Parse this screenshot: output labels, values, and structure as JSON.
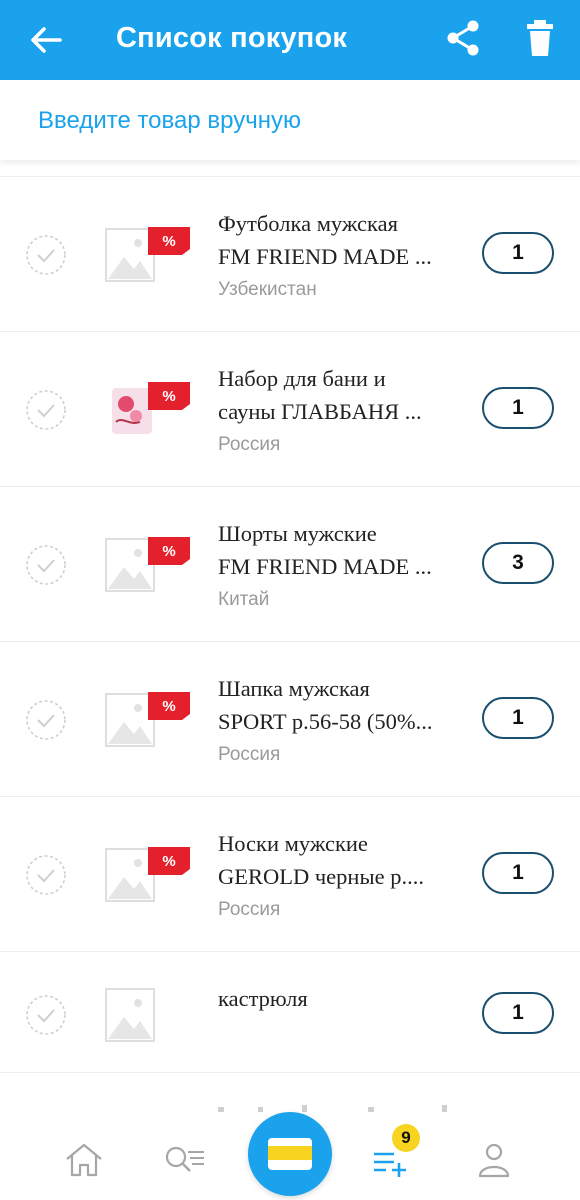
{
  "header": {
    "title": "Список покупок",
    "back_icon": "arrow-left-icon",
    "share_icon": "share-icon",
    "delete_icon": "trash-icon",
    "background": "#1aa3ec"
  },
  "manual_entry": {
    "placeholder": "Введите товар вручную"
  },
  "items": [
    {
      "line1": "Футболка мужская",
      "line2": "FM FRIEND MADE ...",
      "origin": "Узбекистан",
      "qty": "1",
      "image": "placeholder-image",
      "discount": true
    },
    {
      "line1": "Набор для бани и",
      "line2": "сауны ГЛАВБАНЯ ...",
      "origin": "Россия",
      "qty": "1",
      "image": "product-photo",
      "discount": true
    },
    {
      "line1": "Шорты мужские",
      "line2": "FM FRIEND MADE ...",
      "origin": "Китай",
      "qty": "3",
      "image": "placeholder-image",
      "discount": true
    },
    {
      "line1": "Шапка мужская",
      "line2": "SPORT р.56-58 (50%...",
      "origin": "Россия",
      "qty": "1",
      "image": "placeholder-image",
      "discount": true
    },
    {
      "line1": "Носки мужские",
      "line2": "GEROLD черные р....",
      "origin": "Россия",
      "qty": "1",
      "image": "placeholder-image",
      "discount": true
    },
    {
      "line1": "кастрюля",
      "line2": "",
      "origin": "",
      "qty": "1",
      "image": "placeholder-image",
      "discount": false
    }
  ],
  "discount_label": "%",
  "bottom_nav": {
    "home_icon": "home-icon",
    "search_icon": "search-list-icon",
    "card_icon": "loyalty-card-icon",
    "list_icon": "shopping-list-add-icon",
    "profile_icon": "profile-icon",
    "list_badge": "9",
    "badge_color": "#f8d320"
  }
}
